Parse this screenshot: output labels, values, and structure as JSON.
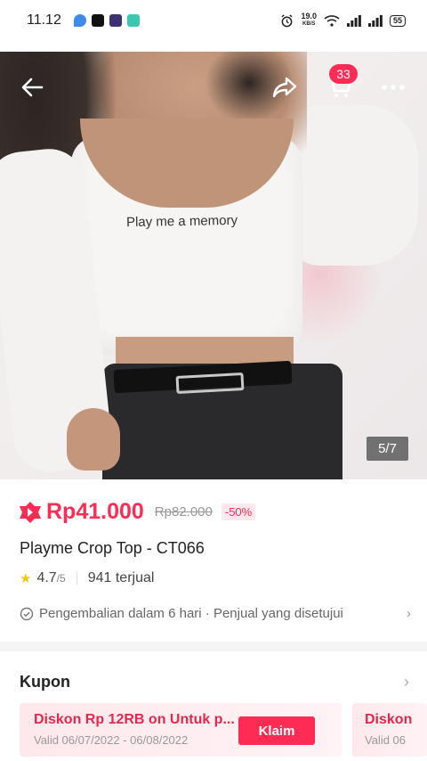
{
  "status_bar": {
    "time": "11.12",
    "net_speed": "19.0",
    "net_unit": "KB/S",
    "battery": "55"
  },
  "header": {
    "cart_count": "33"
  },
  "gallery": {
    "print_text": "Play me a memory",
    "indicator": "5/7"
  },
  "product": {
    "price": "Rp41.000",
    "original_price": "Rp82.000",
    "discount": "-50%",
    "title": "Playme Crop Top - CT066",
    "rating": "4.7",
    "rating_scale": "/5",
    "sold": "941 terjual",
    "policy": "Pengembalian dalam 6 hari · Penjual yang disetujui"
  },
  "coupons": {
    "heading": "Kupon",
    "items": [
      {
        "title": "Diskon Rp 12RB on Untuk p...",
        "valid": "Valid 06/07/2022 - 06/08/2022",
        "claim_label": "Klaim"
      },
      {
        "title": "Diskon",
        "valid": "Valid 06"
      }
    ]
  },
  "colors": {
    "accent": "#fe2c55",
    "coupon_text": "#e0294f"
  }
}
